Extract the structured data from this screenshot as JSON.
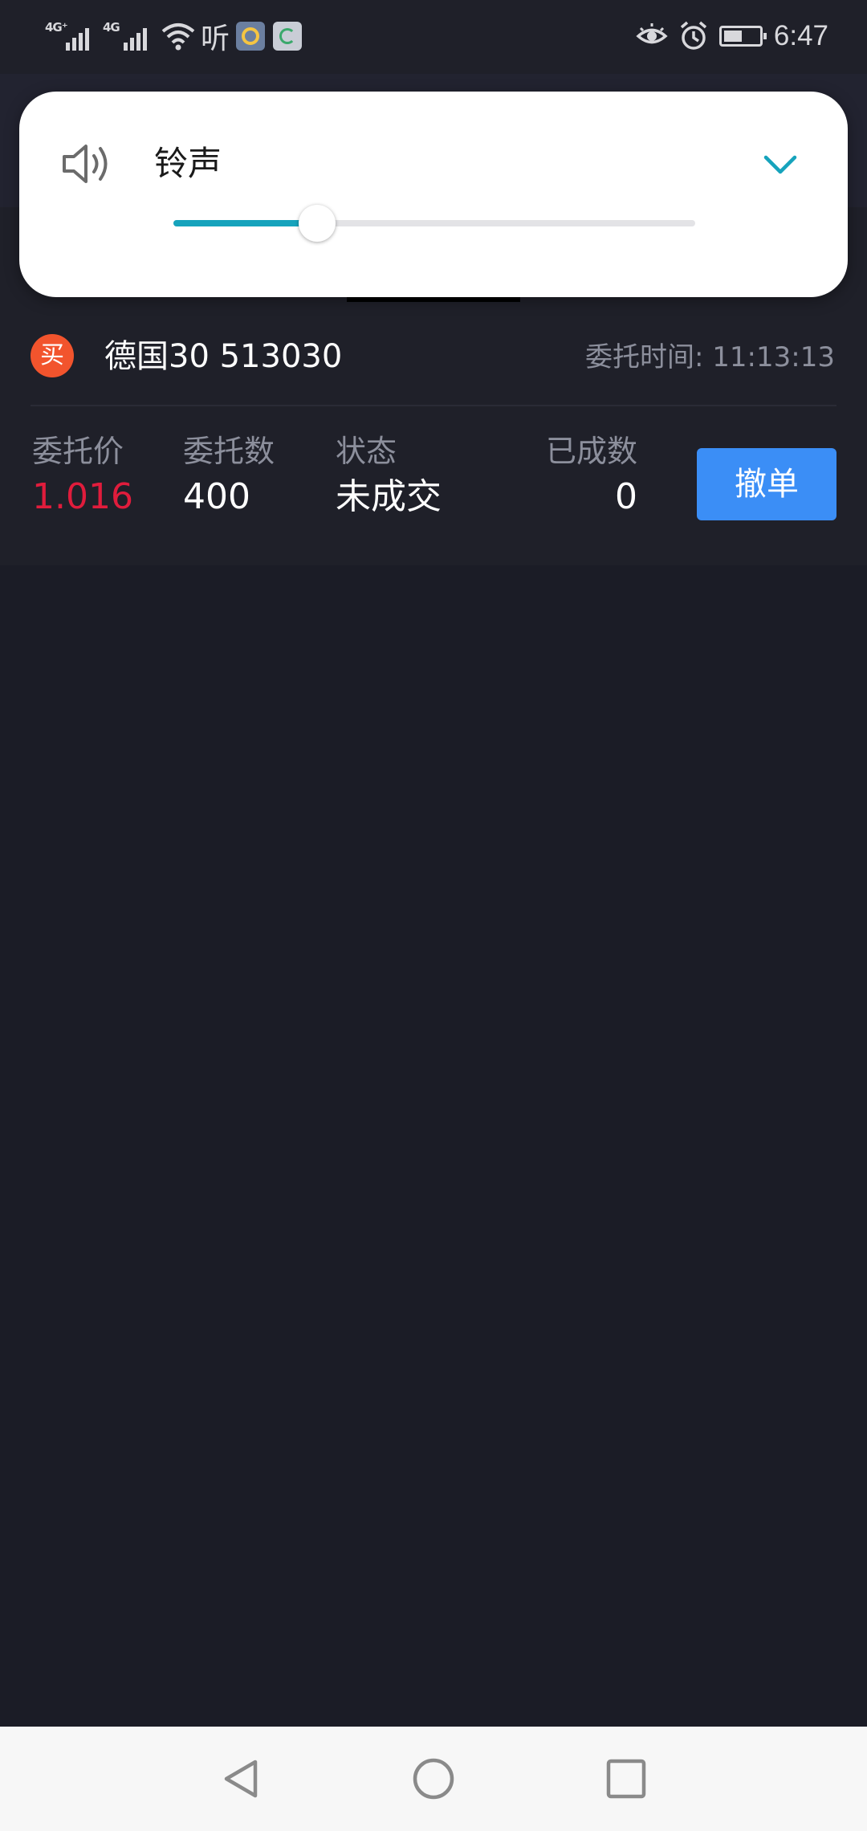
{
  "status_bar": {
    "sim1_network": "4G⁺",
    "sim2_network": "4G",
    "hear_glyph": "听",
    "time": "6:47",
    "icons": [
      "signal-icon",
      "signal-icon",
      "wifi-icon",
      "listen-app-icon",
      "app-icon-blue",
      "app-icon-green",
      "eye-icon",
      "alarm-icon",
      "battery-icon"
    ]
  },
  "volume_panel": {
    "label": "铃声",
    "level_fraction": 0.275,
    "accent_color": "#16a3bc",
    "icons": [
      "speaker-icon",
      "chevron-down-icon"
    ]
  },
  "order": {
    "side_badge": "买",
    "stock": "德国30 513030",
    "time_label": "委托时间: 11:13:13",
    "columns": [
      {
        "label": "委托价",
        "value": "1.016"
      },
      {
        "label": "委托数",
        "value": "400"
      },
      {
        "label": "状态",
        "value": "未成交"
      },
      {
        "label": "已成数",
        "value": "0"
      }
    ],
    "cancel_label": "撤单",
    "colors": {
      "badge": "#f2542d",
      "price": "#e01c3c",
      "button": "#3b8ef6"
    }
  },
  "nav_bar": {
    "icons": [
      "back-icon",
      "home-icon",
      "recents-icon"
    ]
  }
}
